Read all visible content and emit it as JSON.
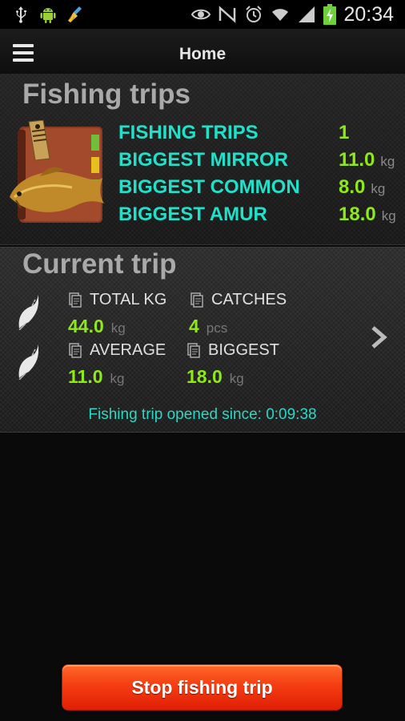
{
  "status_bar": {
    "time": "20:34",
    "battery_color": "#6ed13a",
    "icons_left": [
      "usb-icon",
      "android-debug-icon",
      "cleaner-icon"
    ],
    "icons_right": [
      "eye-icon",
      "nfc-icon",
      "alarm-icon",
      "wifi-icon",
      "signal-icon",
      "battery-charging-icon"
    ]
  },
  "action_bar": {
    "title": "Home",
    "menu_icon": "hamburger-menu-icon"
  },
  "fishing_trips": {
    "heading": "Fishing trips",
    "icon": "fishing-book-icon",
    "stats": [
      {
        "label": "FISHING TRIPS",
        "value": "1",
        "unit": ""
      },
      {
        "label": "BIGGEST MIRROR",
        "value": "11.0",
        "unit": "kg"
      },
      {
        "label": "BIGGEST COMMON",
        "value": "8.0",
        "unit": "kg"
      },
      {
        "label": "BIGGEST AMUR",
        "value": "18.0",
        "unit": "kg"
      }
    ]
  },
  "current_trip": {
    "heading": "Current trip",
    "total_kg": {
      "label": "TOTAL KG",
      "value": "44.0",
      "unit": "kg"
    },
    "catches": {
      "label": "CATCHES",
      "value": "4",
      "unit": "pcs"
    },
    "average": {
      "label": "AVERAGE",
      "value": "11.0",
      "unit": "kg"
    },
    "biggest": {
      "label": "BIGGEST",
      "value": "18.0",
      "unit": "kg"
    },
    "opened_since": "Fishing trip opened since: 0:09:38"
  },
  "colors": {
    "label_cyan": "#22e0c8",
    "value_green": "#8ee81a",
    "button_red": "#f53d12"
  },
  "stop_button": {
    "label": "Stop fishing trip"
  }
}
